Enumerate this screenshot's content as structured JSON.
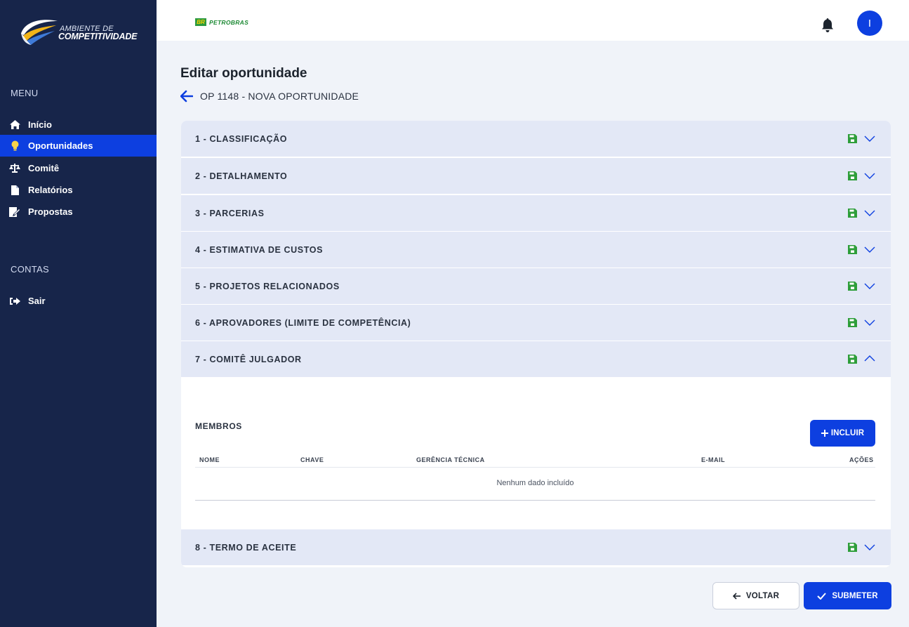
{
  "sidebar": {
    "logo": {
      "line1": "AMBIENTE DE",
      "line2": "COMPETITIVIDADE"
    },
    "menu_title": "MENU",
    "items": [
      {
        "label": "Início",
        "icon": "home-icon"
      },
      {
        "label": "Oportunidades",
        "icon": "lightbulb-icon",
        "active": true
      },
      {
        "label": "Comitê",
        "icon": "balance-scale-icon"
      },
      {
        "label": "Relatórios",
        "icon": "file-icon"
      },
      {
        "label": "Propostas",
        "icon": "signature-icon"
      }
    ],
    "accounts_title": "CONTAS",
    "account_items": [
      {
        "label": "Sair",
        "icon": "sign-out-icon"
      }
    ]
  },
  "header": {
    "brand_box": "BR",
    "brand_text": "PETROBRAS",
    "avatar_initial": "I"
  },
  "main": {
    "page_title": "Editar oportunidade",
    "op_title": "OP 1148 - NOVA OPORTUNIDADE",
    "sections": [
      {
        "label": "1 - CLASSIFICAÇÃO",
        "expanded": false
      },
      {
        "label": "2 - DETALHAMENTO",
        "expanded": false
      },
      {
        "label": "3 - PARCERIAS",
        "expanded": false
      },
      {
        "label": "4 - ESTIMATIVA DE CUSTOS",
        "expanded": false
      },
      {
        "label": "5 - PROJETOS RELACIONADOS",
        "expanded": false
      },
      {
        "label": "6 - APROVADORES (LIMITE DE COMPETÊNCIA)",
        "expanded": false
      },
      {
        "label": "7 - COMITÊ JULGADOR",
        "expanded": true
      },
      {
        "label": "8 - TERMO DE ACEITE",
        "expanded": false
      }
    ],
    "comite": {
      "membros_label": "MEMBROS",
      "incluir_label": "INCLUIR",
      "columns": [
        "NOME",
        "CHAVE",
        "GERÊNCIA TÉCNICA",
        "E-MAIL",
        "AÇÕES"
      ],
      "empty_text": "Nenhum dado incluído"
    }
  },
  "footer": {
    "voltar_label": "VOLTAR",
    "submeter_label": "SUBMETER"
  },
  "colors": {
    "sidebar_bg": "#17254a",
    "accent": "#0d3fe0",
    "section_bg": "#e3e8f6",
    "save_green": "#2e9e3a"
  }
}
